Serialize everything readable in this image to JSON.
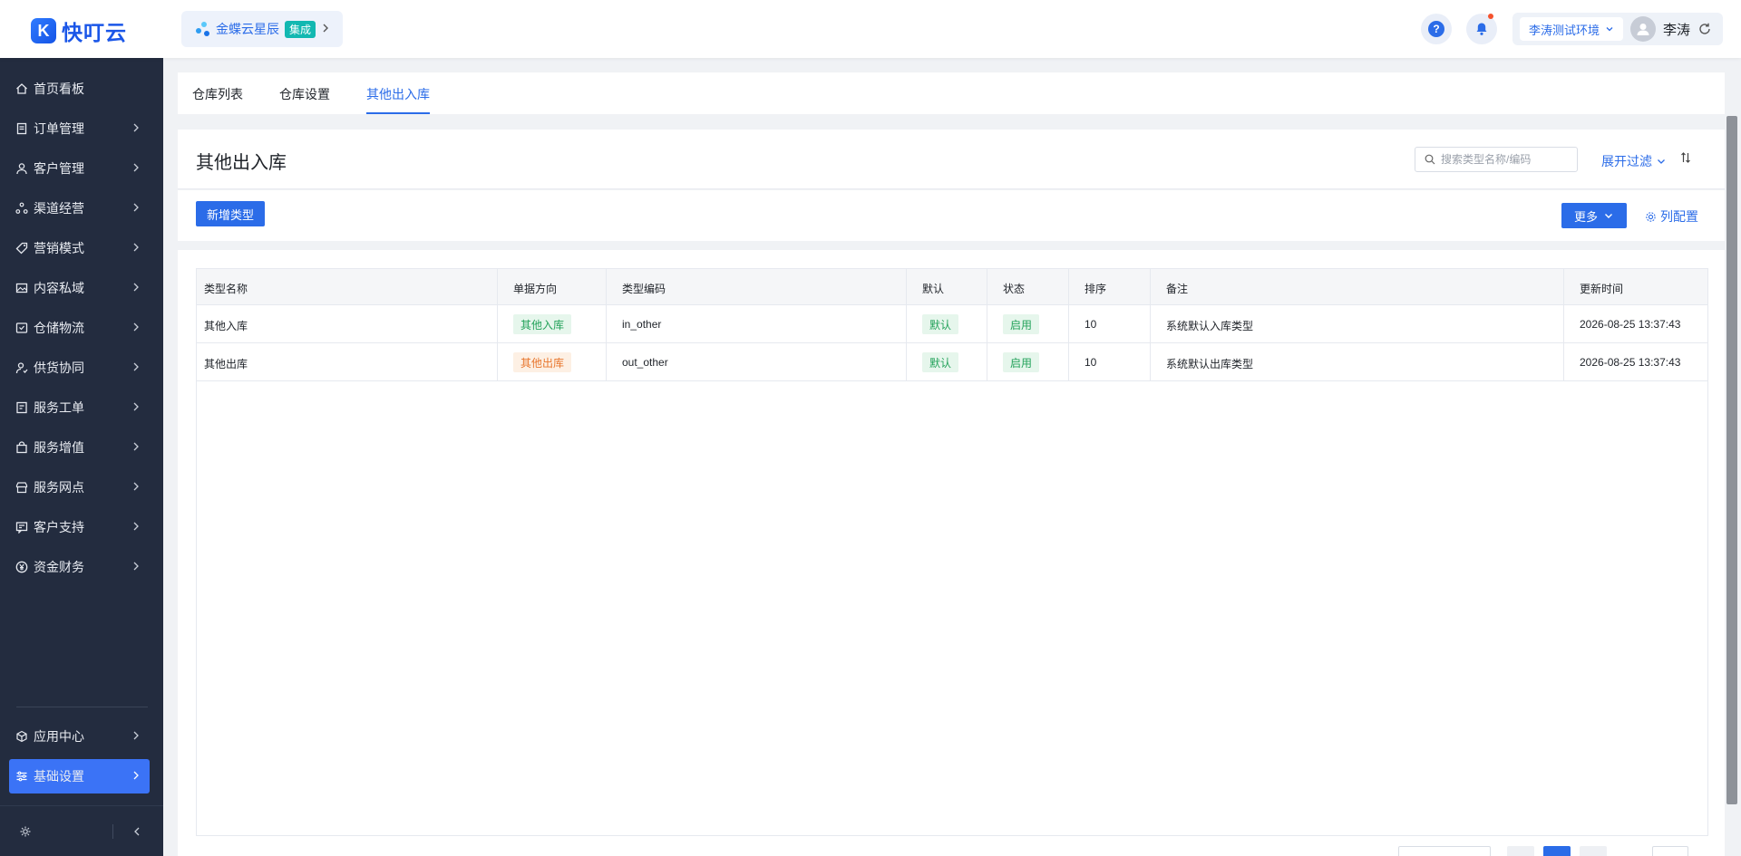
{
  "header": {
    "logo_text": "快叮云",
    "integration_name": "金蝶云星辰",
    "integration_badge": "集成",
    "environment": "李涛测试环境",
    "user_name": "李涛"
  },
  "sidebar": {
    "items": [
      {
        "label": "首页看板",
        "icon": "home-icon"
      },
      {
        "label": "订单管理",
        "icon": "order-icon"
      },
      {
        "label": "客户管理",
        "icon": "customer-icon"
      },
      {
        "label": "渠道经营",
        "icon": "channel-icon"
      },
      {
        "label": "营销模式",
        "icon": "tag-icon"
      },
      {
        "label": "内容私域",
        "icon": "image-icon"
      },
      {
        "label": "仓储物流",
        "icon": "warehouse-icon"
      },
      {
        "label": "供货协同",
        "icon": "supply-icon"
      },
      {
        "label": "服务工单",
        "icon": "ticket-icon"
      },
      {
        "label": "服务增值",
        "icon": "bag-icon"
      },
      {
        "label": "服务网点",
        "icon": "store-icon"
      },
      {
        "label": "客户支持",
        "icon": "support-icon"
      },
      {
        "label": "资金财务",
        "icon": "yuan-icon"
      }
    ],
    "bottom_items": [
      {
        "label": "应用中心",
        "icon": "cube-icon"
      },
      {
        "label": "基础设置",
        "icon": "settings-list-icon"
      }
    ]
  },
  "tabs": [
    "仓库列表",
    "仓库设置",
    "其他出入库"
  ],
  "page": {
    "title": "其他出入库",
    "search_placeholder": "搜索类型名称/编码",
    "filter_toggle": "展开过滤",
    "add_button": "新增类型",
    "more_button": "更多",
    "column_config": "列配置"
  },
  "table": {
    "columns": [
      "类型名称",
      "单据方向",
      "类型编码",
      "默认",
      "状态",
      "排序",
      "备注",
      "更新时间"
    ],
    "rows": [
      {
        "name": "其他入库",
        "direction": "其他入库",
        "code": "in_other",
        "default": "默认",
        "status": "启用",
        "sort": "10",
        "remark": "系统默认入库类型",
        "updated": "2026-08-25 13:37:43"
      },
      {
        "name": "其他出库",
        "direction": "其他出库",
        "code": "out_other",
        "default": "默认",
        "status": "启用",
        "sort": "10",
        "remark": "系统默认出库类型",
        "updated": "2026-08-25 13:37:43"
      }
    ]
  },
  "colors": {
    "accent": "#2b6ce8",
    "sidebar_bg": "#232c3f",
    "tag_green": "#23a25a",
    "tag_orange": "#e8762d"
  }
}
